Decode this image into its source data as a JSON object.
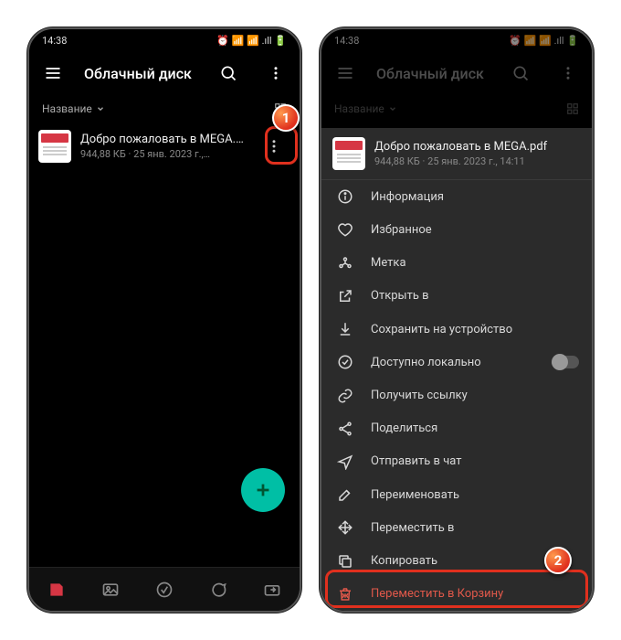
{
  "status": {
    "time": "14:38",
    "icons": "⏰ 📶 📶 .ıll 🔋"
  },
  "app": {
    "title": "Облачный диск",
    "sort_label": "Название"
  },
  "file": {
    "name": "Добро пожаловать в MEGA.pdf",
    "meta_short": "944,88 КБ · 25 янв. 2023 г.,…",
    "meta_long": "944,88 КБ · 25 янв. 2023 г., 14:11"
  },
  "menu": {
    "info": "Информация",
    "fav": "Избранное",
    "tag": "Метка",
    "openin": "Открыть в",
    "save": "Сохранить на устройство",
    "offline": "Доступно локально",
    "link": "Получить ссылку",
    "share": "Поделиться",
    "sendchat": "Отправить в чат",
    "rename": "Переименовать",
    "move": "Переместить в",
    "copy": "Копировать",
    "trash": "Переместить в Корзину"
  },
  "callouts": {
    "one": "1",
    "two": "2"
  }
}
